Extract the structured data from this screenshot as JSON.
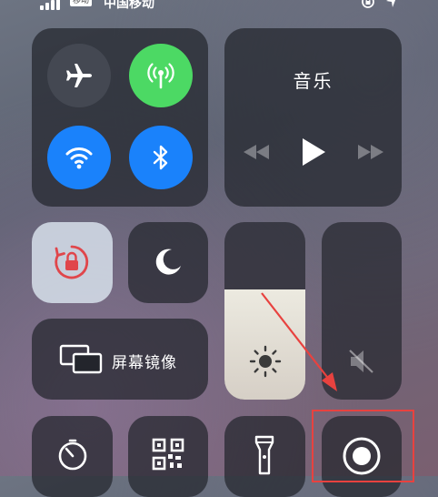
{
  "status_bar": {
    "carrier_badge": "移动",
    "carrier": "中国移动",
    "signal_icon": "signal-bars-icon",
    "orientation_lock_icon": "orientation-lock-icon",
    "location_icon": "location-arrow-icon"
  },
  "connectivity": {
    "airplane": {
      "icon": "airplane-icon",
      "state": "off"
    },
    "cellular": {
      "icon": "cellular-antenna-icon",
      "state": "on"
    },
    "wifi": {
      "icon": "wifi-icon",
      "state": "on"
    },
    "bluetooth": {
      "icon": "bluetooth-icon",
      "state": "on"
    }
  },
  "music": {
    "title": "音乐",
    "prev_icon": "rewind-icon",
    "play_icon": "play-icon",
    "next_icon": "fast-forward-icon"
  },
  "toggles": {
    "orientation_lock": {
      "icon": "lock-rotation-icon",
      "state": "on"
    },
    "do_not_disturb": {
      "icon": "moon-icon",
      "state": "off"
    }
  },
  "screen_mirroring": {
    "label": "屏幕镜像",
    "icon": "screen-mirroring-icon"
  },
  "brightness": {
    "level": 0.62,
    "icon": "sun-icon"
  },
  "volume": {
    "level": 0.0,
    "icon": "speaker-muted-icon"
  },
  "bottom_row": [
    {
      "icon": "timer-icon"
    },
    {
      "icon": "qr-code-icon"
    },
    {
      "icon": "flashlight-icon"
    },
    {
      "icon": "screen-record-icon"
    }
  ],
  "colors": {
    "cellular_on": "#4cd964",
    "blue_on": "#1a82fb",
    "lock_red": "#e0464b",
    "highlight": "#e8423f"
  }
}
